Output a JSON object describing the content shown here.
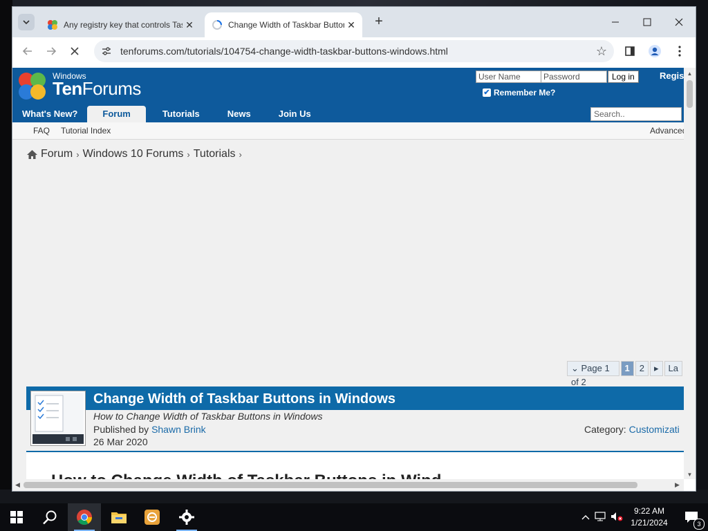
{
  "browser": {
    "tabs": [
      {
        "title": "Any registry key that controls Taskbar",
        "active": false
      },
      {
        "title": "Change Width of Taskbar Buttons in Windows",
        "active": true
      }
    ],
    "new_tab_label": "+",
    "url": "tenforums.com/tutorials/104754-change-width-taskbar-buttons-windows.html",
    "loading": true
  },
  "site": {
    "logo": {
      "small": "Windows",
      "brand_bold": "Ten",
      "brand_rest": "Forums"
    },
    "login": {
      "username_placeholder": "User Name",
      "password_placeholder": "Password",
      "login_label": "Log in",
      "register_label": "Regis",
      "remember_label": "Remember Me?",
      "remember_checked": true
    },
    "nav": [
      {
        "label": "What's New?",
        "active": false
      },
      {
        "label": "Forum",
        "active": true
      },
      {
        "label": "Tutorials",
        "active": false
      },
      {
        "label": "News",
        "active": false
      },
      {
        "label": "Join Us",
        "active": false
      }
    ],
    "search_placeholder": "Search..",
    "subnav": {
      "faq": "FAQ",
      "tutorial_index": "Tutorial Index",
      "advanced": "Advanced"
    },
    "breadcrumb": [
      "Forum",
      "Windows 10 Forums",
      "Tutorials"
    ],
    "pager": {
      "label": "Page 1 of 2",
      "current": "1",
      "next_page": "2",
      "last": "La"
    },
    "article": {
      "title": "Change Width of Taskbar Buttons in Windows",
      "subtitle": "How to Change Width of Taskbar Buttons in Windows",
      "published_by_label": "Published by ",
      "author": "Shawn Brink",
      "date": "26 Mar 2020",
      "category_label": "Category: ",
      "category": "Customizati",
      "body_heading": "How to Change Width of Taskbar Buttons in Wind"
    }
  },
  "taskbar": {
    "time": "9:22 AM",
    "date": "1/21/2024",
    "notification_count": "3"
  },
  "colors": {
    "site_blue": "#0e5a9c",
    "article_bar": "#0e6aa8",
    "link": "#1a6aa8"
  }
}
